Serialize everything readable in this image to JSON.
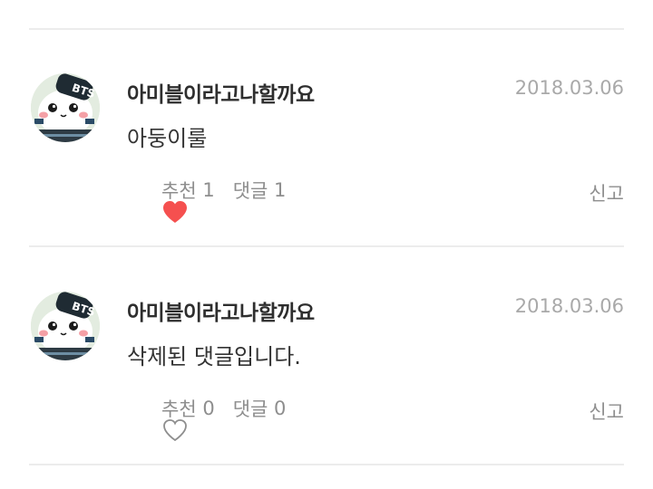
{
  "comments": [
    {
      "author": "아미블이라고나할까요",
      "date": "2018.03.06",
      "content": "아둥이룰",
      "liked": true,
      "like_label": "추천",
      "like_count": "1",
      "reply_label": "댓글",
      "reply_count": "1",
      "report_label": "신고",
      "avatar_badge": "BTS",
      "heart_icon": "heart-filled-icon",
      "heart_color": "#f5504f"
    },
    {
      "author": "아미블이라고나할까요",
      "date": "2018.03.06",
      "content": "삭제된 댓글입니다.",
      "liked": false,
      "like_label": "추천",
      "like_count": "0",
      "reply_label": "댓글",
      "reply_count": "0",
      "report_label": "신고",
      "avatar_badge": "BTS",
      "heart_icon": "heart-outline-icon",
      "heart_color": "#8e8e8e"
    }
  ]
}
